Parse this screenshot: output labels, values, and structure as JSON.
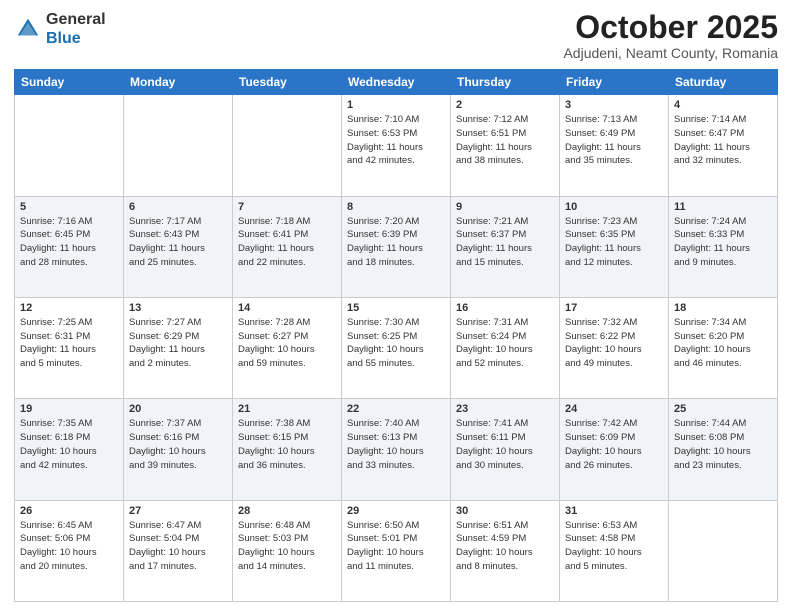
{
  "header": {
    "logo": {
      "line1": "General",
      "line2": "Blue"
    },
    "title": "October 2025",
    "location": "Adjudeni, Neamt County, Romania"
  },
  "weekdays": [
    "Sunday",
    "Monday",
    "Tuesday",
    "Wednesday",
    "Thursday",
    "Friday",
    "Saturday"
  ],
  "weeks": [
    [
      {
        "day": "",
        "info": ""
      },
      {
        "day": "",
        "info": ""
      },
      {
        "day": "",
        "info": ""
      },
      {
        "day": "1",
        "info": "Sunrise: 7:10 AM\nSunset: 6:53 PM\nDaylight: 11 hours\nand 42 minutes."
      },
      {
        "day": "2",
        "info": "Sunrise: 7:12 AM\nSunset: 6:51 PM\nDaylight: 11 hours\nand 38 minutes."
      },
      {
        "day": "3",
        "info": "Sunrise: 7:13 AM\nSunset: 6:49 PM\nDaylight: 11 hours\nand 35 minutes."
      },
      {
        "day": "4",
        "info": "Sunrise: 7:14 AM\nSunset: 6:47 PM\nDaylight: 11 hours\nand 32 minutes."
      }
    ],
    [
      {
        "day": "5",
        "info": "Sunrise: 7:16 AM\nSunset: 6:45 PM\nDaylight: 11 hours\nand 28 minutes."
      },
      {
        "day": "6",
        "info": "Sunrise: 7:17 AM\nSunset: 6:43 PM\nDaylight: 11 hours\nand 25 minutes."
      },
      {
        "day": "7",
        "info": "Sunrise: 7:18 AM\nSunset: 6:41 PM\nDaylight: 11 hours\nand 22 minutes."
      },
      {
        "day": "8",
        "info": "Sunrise: 7:20 AM\nSunset: 6:39 PM\nDaylight: 11 hours\nand 18 minutes."
      },
      {
        "day": "9",
        "info": "Sunrise: 7:21 AM\nSunset: 6:37 PM\nDaylight: 11 hours\nand 15 minutes."
      },
      {
        "day": "10",
        "info": "Sunrise: 7:23 AM\nSunset: 6:35 PM\nDaylight: 11 hours\nand 12 minutes."
      },
      {
        "day": "11",
        "info": "Sunrise: 7:24 AM\nSunset: 6:33 PM\nDaylight: 11 hours\nand 9 minutes."
      }
    ],
    [
      {
        "day": "12",
        "info": "Sunrise: 7:25 AM\nSunset: 6:31 PM\nDaylight: 11 hours\nand 5 minutes."
      },
      {
        "day": "13",
        "info": "Sunrise: 7:27 AM\nSunset: 6:29 PM\nDaylight: 11 hours\nand 2 minutes."
      },
      {
        "day": "14",
        "info": "Sunrise: 7:28 AM\nSunset: 6:27 PM\nDaylight: 10 hours\nand 59 minutes."
      },
      {
        "day": "15",
        "info": "Sunrise: 7:30 AM\nSunset: 6:25 PM\nDaylight: 10 hours\nand 55 minutes."
      },
      {
        "day": "16",
        "info": "Sunrise: 7:31 AM\nSunset: 6:24 PM\nDaylight: 10 hours\nand 52 minutes."
      },
      {
        "day": "17",
        "info": "Sunrise: 7:32 AM\nSunset: 6:22 PM\nDaylight: 10 hours\nand 49 minutes."
      },
      {
        "day": "18",
        "info": "Sunrise: 7:34 AM\nSunset: 6:20 PM\nDaylight: 10 hours\nand 46 minutes."
      }
    ],
    [
      {
        "day": "19",
        "info": "Sunrise: 7:35 AM\nSunset: 6:18 PM\nDaylight: 10 hours\nand 42 minutes."
      },
      {
        "day": "20",
        "info": "Sunrise: 7:37 AM\nSunset: 6:16 PM\nDaylight: 10 hours\nand 39 minutes."
      },
      {
        "day": "21",
        "info": "Sunrise: 7:38 AM\nSunset: 6:15 PM\nDaylight: 10 hours\nand 36 minutes."
      },
      {
        "day": "22",
        "info": "Sunrise: 7:40 AM\nSunset: 6:13 PM\nDaylight: 10 hours\nand 33 minutes."
      },
      {
        "day": "23",
        "info": "Sunrise: 7:41 AM\nSunset: 6:11 PM\nDaylight: 10 hours\nand 30 minutes."
      },
      {
        "day": "24",
        "info": "Sunrise: 7:42 AM\nSunset: 6:09 PM\nDaylight: 10 hours\nand 26 minutes."
      },
      {
        "day": "25",
        "info": "Sunrise: 7:44 AM\nSunset: 6:08 PM\nDaylight: 10 hours\nand 23 minutes."
      }
    ],
    [
      {
        "day": "26",
        "info": "Sunrise: 6:45 AM\nSunset: 5:06 PM\nDaylight: 10 hours\nand 20 minutes."
      },
      {
        "day": "27",
        "info": "Sunrise: 6:47 AM\nSunset: 5:04 PM\nDaylight: 10 hours\nand 17 minutes."
      },
      {
        "day": "28",
        "info": "Sunrise: 6:48 AM\nSunset: 5:03 PM\nDaylight: 10 hours\nand 14 minutes."
      },
      {
        "day": "29",
        "info": "Sunrise: 6:50 AM\nSunset: 5:01 PM\nDaylight: 10 hours\nand 11 minutes."
      },
      {
        "day": "30",
        "info": "Sunrise: 6:51 AM\nSunset: 4:59 PM\nDaylight: 10 hours\nand 8 minutes."
      },
      {
        "day": "31",
        "info": "Sunrise: 6:53 AM\nSunset: 4:58 PM\nDaylight: 10 hours\nand 5 minutes."
      },
      {
        "day": "",
        "info": ""
      }
    ]
  ]
}
